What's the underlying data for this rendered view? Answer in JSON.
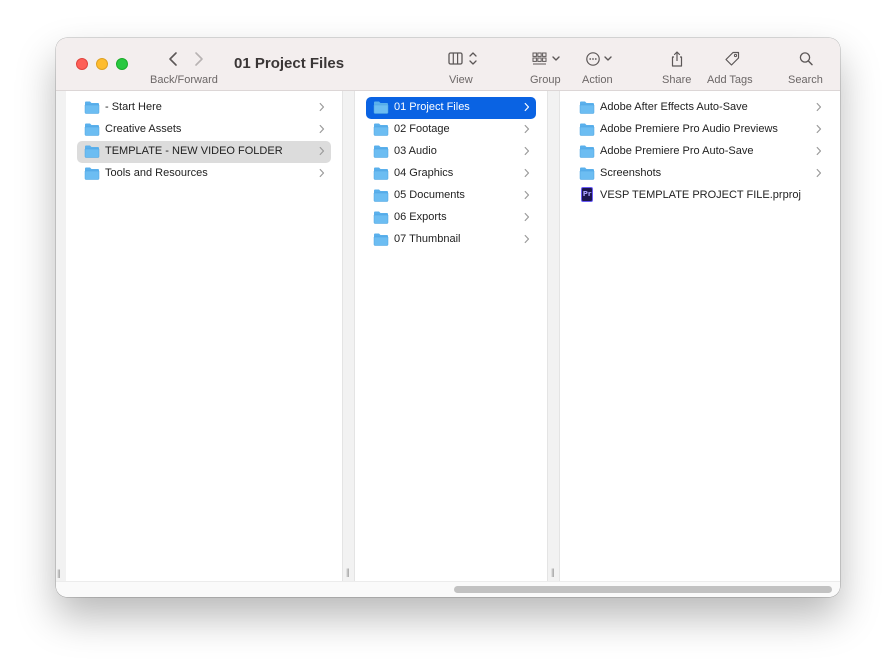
{
  "window": {
    "title": "01 Project Files"
  },
  "toolbar": {
    "back_forward_label": "Back/Forward",
    "view_label": "View",
    "group_label": "Group",
    "action_label": "Action",
    "share_label": "Share",
    "add_tags_label": "Add Tags",
    "search_label": "Search"
  },
  "columns": [
    {
      "items": [
        {
          "label": "- Start Here",
          "icon": "folder-icon",
          "chevron": true
        },
        {
          "label": "Creative Assets",
          "icon": "folder-icon",
          "chevron": true
        },
        {
          "label": "TEMPLATE - NEW VIDEO FOLDER",
          "icon": "folder-icon",
          "chevron": true,
          "selected": "inactive"
        },
        {
          "label": "Tools and Resources",
          "icon": "folder-icon",
          "chevron": true
        }
      ]
    },
    {
      "items": [
        {
          "label": "01 Project Files",
          "icon": "folder-icon",
          "chevron": true,
          "selected": "active"
        },
        {
          "label": "02 Footage",
          "icon": "folder-icon",
          "chevron": true
        },
        {
          "label": "03 Audio",
          "icon": "folder-icon",
          "chevron": true
        },
        {
          "label": "04 Graphics",
          "icon": "folder-icon",
          "chevron": true
        },
        {
          "label": "05 Documents",
          "icon": "folder-icon",
          "chevron": true
        },
        {
          "label": "06 Exports",
          "icon": "folder-icon",
          "chevron": true
        },
        {
          "label": "07 Thumbnail",
          "icon": "folder-icon",
          "chevron": true
        }
      ]
    },
    {
      "items": [
        {
          "label": "Adobe After Effects Auto-Save",
          "icon": "folder-icon",
          "chevron": true
        },
        {
          "label": "Adobe Premiere Pro Audio Previews",
          "icon": "folder-icon",
          "chevron": true
        },
        {
          "label": "Adobe Premiere Pro Auto-Save",
          "icon": "folder-icon",
          "chevron": true
        },
        {
          "label": "Screenshots",
          "icon": "folder-icon",
          "chevron": true
        },
        {
          "label": "VESP TEMPLATE PROJECT FILE.prproj",
          "icon": "premiere-project-icon",
          "icon_text": "Pr",
          "chevron": false
        }
      ]
    }
  ],
  "colors": {
    "selection_active": "#0a63e3",
    "selection_inactive": "#dcdcdc",
    "folder": "#5ab0ec",
    "toolbar_bg": "#f3eeee"
  }
}
